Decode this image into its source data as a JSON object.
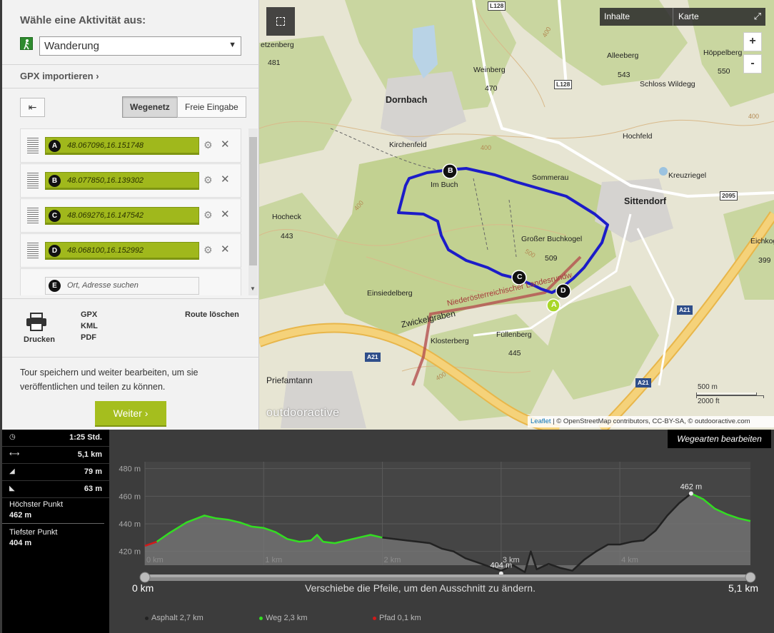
{
  "panel": {
    "activity_title": "Wähle eine Aktivität aus:",
    "activity_value": "Wanderung",
    "gpx_import": "GPX importieren",
    "back_symbol": "⇤",
    "tab_network": "Wegenetz",
    "tab_free": "Freie Eingabe",
    "waypoints": [
      {
        "letter": "A",
        "value": "48.067096,16.151748"
      },
      {
        "letter": "B",
        "value": "48.077850,16.139302"
      },
      {
        "letter": "C",
        "value": "48.069276,16.147542"
      },
      {
        "letter": "D",
        "value": "48.068100,16.152992"
      }
    ],
    "search_point": {
      "letter": "E",
      "placeholder": "Ort, Adresse suchen"
    },
    "print_label": "Drucken",
    "export_formats": [
      "GPX",
      "KML",
      "PDF"
    ],
    "route_delete": "Route löschen",
    "save_text": "Tour speichern und weiter bearbeiten, um sie veröffentlichen und teilen zu können.",
    "next_button": "Weiter ›"
  },
  "map": {
    "controls": {
      "tab_contents": "Inhalte",
      "tab_map": "Karte",
      "zoom_in": "+",
      "zoom_out": "-"
    },
    "places": [
      {
        "name": "Dornbach",
        "kind": "big"
      },
      {
        "name": "Sittendorf",
        "kind": "big"
      },
      {
        "name": "Kirchenfeld",
        "kind": "normal"
      },
      {
        "name": "Hochfeld",
        "kind": "normal"
      },
      {
        "name": "Sommerau",
        "kind": "normal"
      },
      {
        "name": "Im Buch",
        "kind": "normal"
      },
      {
        "name": "Großer Buchkogel",
        "kind": "normal"
      },
      {
        "name": "Einsiedelberg",
        "kind": "normal"
      },
      {
        "name": "Zwickelgraben",
        "kind": "normal"
      },
      {
        "name": "Klosterberg",
        "kind": "normal"
      },
      {
        "name": "Füllenberg",
        "kind": "normal"
      },
      {
        "name": "Priefamtann",
        "kind": "normal"
      },
      {
        "name": "Hocheck",
        "kind": "normal"
      },
      {
        "name": "Alleeberg",
        "kind": "normal"
      },
      {
        "name": "Höppelberg",
        "kind": "normal"
      },
      {
        "name": "Schloss Wildegg",
        "kind": "normal"
      },
      {
        "name": "Weinberg",
        "kind": "normal"
      },
      {
        "name": "Kreuzriegel",
        "kind": "normal"
      },
      {
        "name": "Eichkogel",
        "kind": "normal"
      },
      {
        "name": "etzenberg",
        "kind": "normal"
      },
      {
        "name": "Niederösterreichischer Landesrundwanderweg",
        "kind": "normal"
      }
    ],
    "elevations": [
      "481",
      "470",
      "543",
      "550",
      "443",
      "509",
      "445",
      "399"
    ],
    "contour_labels": [
      "400",
      "400",
      "400",
      "500",
      "400",
      "400"
    ],
    "roads": {
      "l128_a": "L128",
      "l128_b": "L128",
      "n2095": "2095",
      "a21_a": "A21",
      "a21_b": "A21",
      "a21_c": "A21"
    },
    "route_markers": [
      "A",
      "B",
      "C",
      "D"
    ],
    "scale_metric": "500 m",
    "scale_imperial": "2000 ft",
    "brand": "outdooractive",
    "attribution_leaflet": "Leaflet",
    "attribution_rest": "| © OpenStreetMap contributors, CC-BY-SA, © outdooractive.com",
    "route_color": "#1c1cc8"
  },
  "stats": {
    "duration": "1:25 Std.",
    "distance": "5,1 km",
    "ascent": "79 m",
    "descent": "63 m",
    "highest_label": "Höchster Punkt",
    "highest_value": "462 m",
    "lowest_label": "Tiefster Punkt",
    "lowest_value": "404 m"
  },
  "profile": {
    "edit_button": "Wegearten bearbeiten",
    "slider_start": "0 km",
    "slider_end": "5,1 km",
    "slider_hint": "Verschiebe die Pfeile, um den Ausschnitt zu ändern.",
    "legend": [
      {
        "label": "Asphalt 2,7 km",
        "color": "#222222"
      },
      {
        "label": "Weg 2,3 km",
        "color": "#33dd22"
      },
      {
        "label": "Pfad 0,1 km",
        "color": "#d01a1a"
      }
    ]
  },
  "chart_data": {
    "type": "area",
    "title": "",
    "xlabel": "",
    "ylabel": "",
    "x_ticks": [
      "0 km",
      "1 km",
      "2 km",
      "3 km",
      "4 km"
    ],
    "y_ticks": [
      "480 m",
      "460 m",
      "440 m",
      "420 m"
    ],
    "xlim": [
      0,
      5.1
    ],
    "ylim": [
      410,
      485
    ],
    "grid": true,
    "annotations": [
      {
        "label": "462 m",
        "x": 4.6,
        "y": 462
      },
      {
        "label": "404 m",
        "x": 3.0,
        "y": 404
      }
    ],
    "series": [
      {
        "points": [
          [
            0.0,
            424
          ],
          [
            0.1,
            427
          ],
          [
            0.2,
            433
          ],
          [
            0.35,
            441
          ],
          [
            0.5,
            446
          ],
          [
            0.6,
            444
          ],
          [
            0.7,
            443
          ],
          [
            0.8,
            441
          ],
          [
            0.9,
            438
          ],
          [
            1.0,
            437
          ],
          [
            1.1,
            434
          ],
          [
            1.2,
            429
          ],
          [
            1.3,
            427
          ],
          [
            1.4,
            428
          ],
          [
            1.45,
            432
          ],
          [
            1.5,
            427
          ],
          [
            1.6,
            426
          ],
          [
            1.7,
            428
          ],
          [
            1.8,
            430
          ],
          [
            1.9,
            432
          ],
          [
            2.0,
            430
          ],
          [
            2.1,
            429
          ],
          [
            2.2,
            428
          ],
          [
            2.3,
            427
          ],
          [
            2.4,
            426
          ],
          [
            2.5,
            422
          ],
          [
            2.6,
            420
          ],
          [
            2.7,
            415
          ],
          [
            2.8,
            412
          ],
          [
            2.9,
            409
          ],
          [
            3.0,
            406
          ],
          [
            3.1,
            410
          ],
          [
            3.2,
            405
          ],
          [
            3.25,
            420
          ],
          [
            3.3,
            407
          ],
          [
            3.4,
            411
          ],
          [
            3.5,
            408
          ],
          [
            3.6,
            406
          ],
          [
            3.7,
            414
          ],
          [
            3.8,
            420
          ],
          [
            3.9,
            425
          ],
          [
            4.0,
            425
          ],
          [
            4.1,
            427
          ],
          [
            4.2,
            428
          ],
          [
            4.3,
            435
          ],
          [
            4.4,
            446
          ],
          [
            4.5,
            455
          ],
          [
            4.6,
            462
          ],
          [
            4.7,
            458
          ],
          [
            4.8,
            451
          ],
          [
            4.9,
            447
          ],
          [
            5.0,
            444
          ],
          [
            5.1,
            442
          ]
        ],
        "segments": [
          {
            "from": 0.0,
            "to": 0.1,
            "surface": "Pfad"
          },
          {
            "from": 0.1,
            "to": 2.0,
            "surface": "Weg"
          },
          {
            "from": 2.0,
            "to": 4.6,
            "surface": "Asphalt"
          },
          {
            "from": 4.6,
            "to": 5.1,
            "surface": "Weg"
          }
        ]
      }
    ]
  }
}
